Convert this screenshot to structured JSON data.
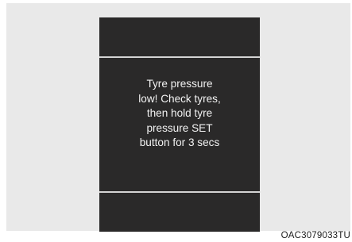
{
  "display": {
    "message_lines": [
      "Tyre pressure",
      "low! Check tyres,",
      "then hold tyre",
      "pressure SET",
      "button for 3 secs"
    ]
  },
  "figure": {
    "code": "OAC3079033TU"
  }
}
